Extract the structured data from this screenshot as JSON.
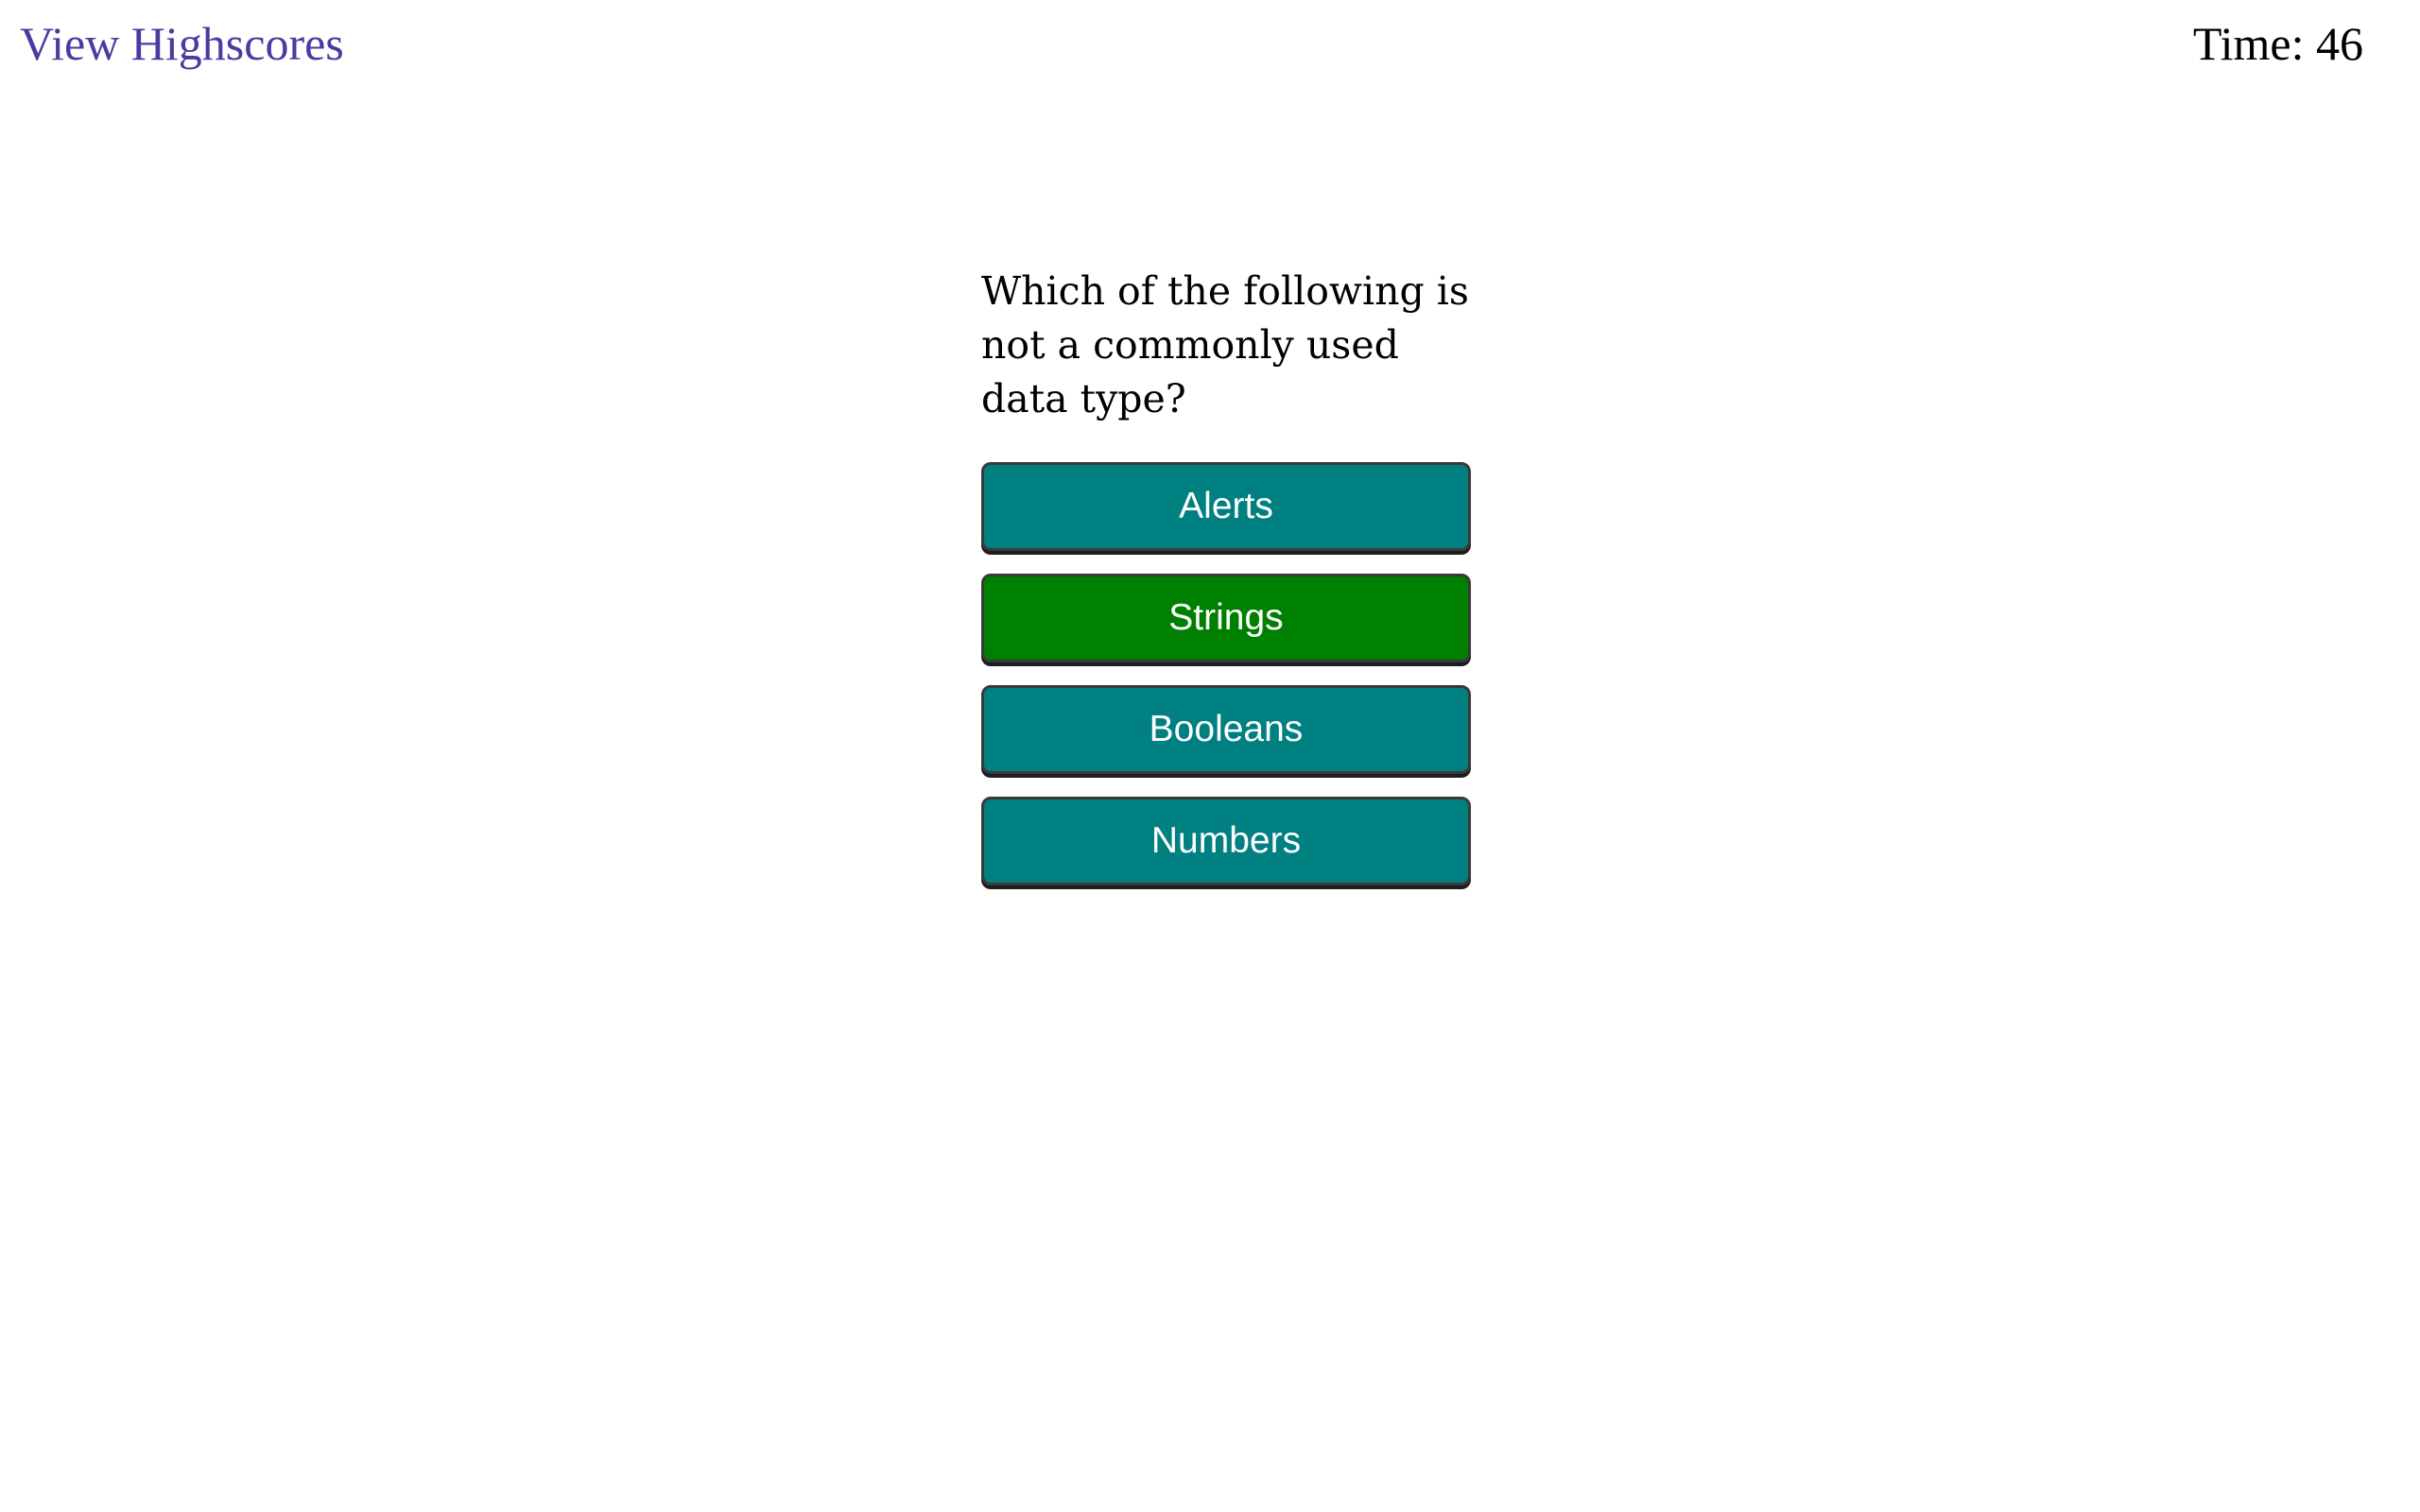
{
  "header": {
    "highscores_label": "View Highscores",
    "timer_label": "Time: 46"
  },
  "quiz": {
    "question": "Which of the following is not a commonly used data type?",
    "answers": [
      {
        "label": "Alerts",
        "color": "#008080"
      },
      {
        "label": "Strings",
        "color": "#008000"
      },
      {
        "label": "Booleans",
        "color": "#008080"
      },
      {
        "label": "Numbers",
        "color": "#008080"
      }
    ]
  },
  "colors": {
    "link": "#4b3aa0",
    "answer_default": "#008080",
    "answer_highlight": "#008000"
  }
}
